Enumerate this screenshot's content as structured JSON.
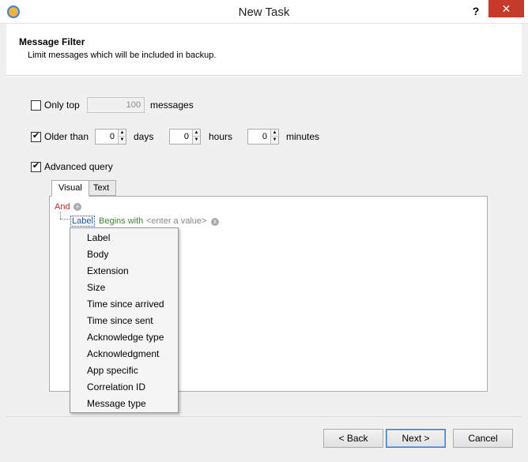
{
  "window": {
    "title": "New Task",
    "help_glyph": "?",
    "close_glyph": "✕"
  },
  "header": {
    "title": "Message Filter",
    "subtitle": "Limit messages which will be included in backup."
  },
  "only_top": {
    "label": "Only top",
    "value": "100",
    "suffix": "messages",
    "checked": false
  },
  "older_than": {
    "label": "Older than",
    "checked": true,
    "days": {
      "value": "0",
      "label": "days"
    },
    "hours": {
      "value": "0",
      "label": "hours"
    },
    "minutes": {
      "value": "0",
      "label": "minutes"
    }
  },
  "advanced_query": {
    "label": "Advanced query",
    "checked": true
  },
  "tabs": [
    {
      "label": "Visual"
    },
    {
      "label": "Text"
    }
  ],
  "query": {
    "operator": "And",
    "condition": {
      "field": "Label",
      "op": "Begins with",
      "value": "<enter a value>"
    }
  },
  "dropdown": {
    "items": [
      "Label",
      "Body",
      "Extension",
      "Size",
      "Time since arrived",
      "Time since sent",
      "Acknowledge type",
      "Acknowledgment",
      "App specific",
      "Correlation ID",
      "Message type"
    ]
  },
  "footer": {
    "back": "< Back",
    "next": "Next >",
    "cancel": "Cancel"
  },
  "icons": {
    "plus": "+",
    "remove": "x",
    "up": "▲",
    "down": "▼"
  }
}
